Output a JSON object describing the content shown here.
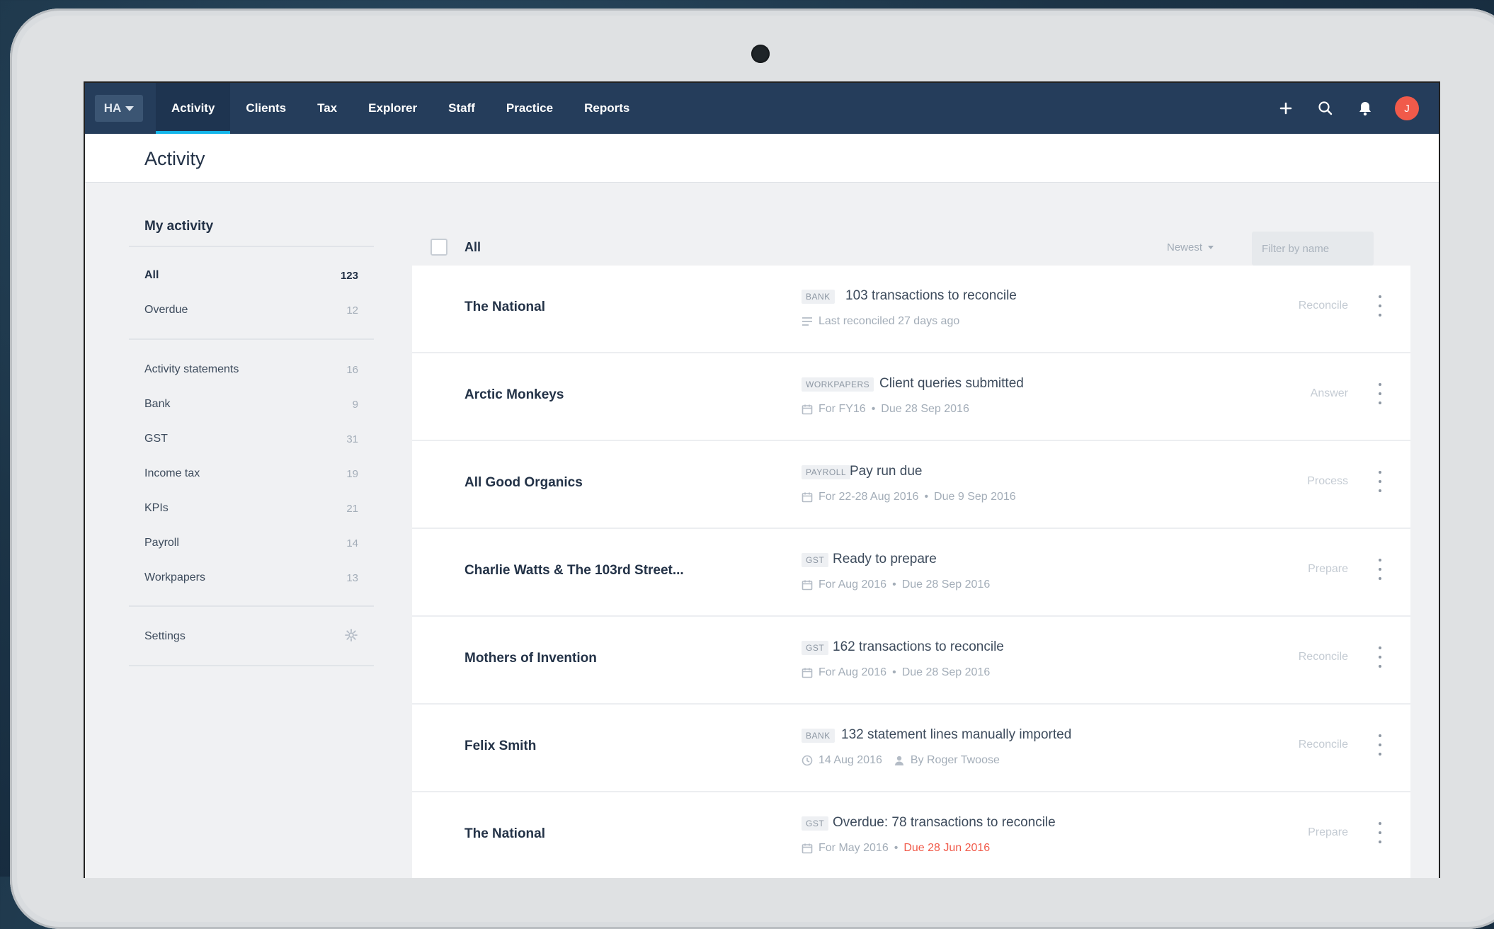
{
  "nav": {
    "org_label": "HA",
    "items": [
      "Activity",
      "Clients",
      "Tax",
      "Explorer",
      "Staff",
      "Practice",
      "Reports"
    ],
    "active_index": 0,
    "avatar_initial": "J",
    "accent_color": "#13b5ea",
    "avatar_color": "#f15a4a"
  },
  "page": {
    "title": "Activity"
  },
  "sidebar": {
    "title": "My activity",
    "primary": [
      {
        "label": "All",
        "count": "123"
      },
      {
        "label": "Overdue",
        "count": "12"
      }
    ],
    "categories": [
      {
        "label": "Activity statements",
        "count": "16"
      },
      {
        "label": "Bank",
        "count": "9"
      },
      {
        "label": "GST",
        "count": "31"
      },
      {
        "label": "Income tax",
        "count": "19"
      },
      {
        "label": "KPIs",
        "count": "21"
      },
      {
        "label": "Payroll",
        "count": "14"
      },
      {
        "label": "Workpapers",
        "count": "13"
      }
    ],
    "settings_label": "Settings"
  },
  "list": {
    "select_all_label": "All",
    "sort_label": "Newest",
    "filter_placeholder": "Filter by name",
    "rows": [
      {
        "client": "The National",
        "tag": "BANK",
        "title": "103 transactions to reconcile",
        "meta_icon": "list-icon",
        "meta1": "Last reconciled 27 days ago",
        "meta2": "",
        "action": "Reconcile"
      },
      {
        "client": "Arctic Monkeys",
        "tag": "WORKPAPERS",
        "title": "Client queries submitted",
        "meta_icon": "calendar-icon",
        "meta1": "For FY16",
        "meta2": "Due 28 Sep 2016",
        "action": "Answer"
      },
      {
        "client": "All Good Organics",
        "tag": "PAYROLL",
        "title": "Pay run due",
        "meta_icon": "calendar-icon",
        "meta1": "For 22-28 Aug 2016",
        "meta2": "Due 9 Sep 2016",
        "action": "Process"
      },
      {
        "client": "Charlie Watts & The 103rd Street...",
        "tag": "GST",
        "title": "Ready to prepare",
        "meta_icon": "calendar-icon",
        "meta1": "For Aug 2016",
        "meta2": "Due 28 Sep 2016",
        "action": "Prepare"
      },
      {
        "client": "Mothers of Invention",
        "tag": "GST",
        "title": "162 transactions to reconcile",
        "meta_icon": "calendar-icon",
        "meta1": "For Aug 2016",
        "meta2": "Due 28 Sep 2016",
        "action": "Reconcile"
      },
      {
        "client": "Felix Smith",
        "tag": "BANK",
        "title": "132 statement lines manually imported",
        "meta_icon": "clock-icon",
        "meta1": "14 Aug 2016",
        "meta2": "By Roger Twoose",
        "action": "Reconcile"
      },
      {
        "client": "The National",
        "tag": "GST",
        "title": "Overdue: 78 transactions to reconcile",
        "meta_icon": "calendar-icon",
        "meta1": "For May 2016",
        "meta2": "Due 28 Jun 2016",
        "action": "Prepare"
      }
    ]
  }
}
